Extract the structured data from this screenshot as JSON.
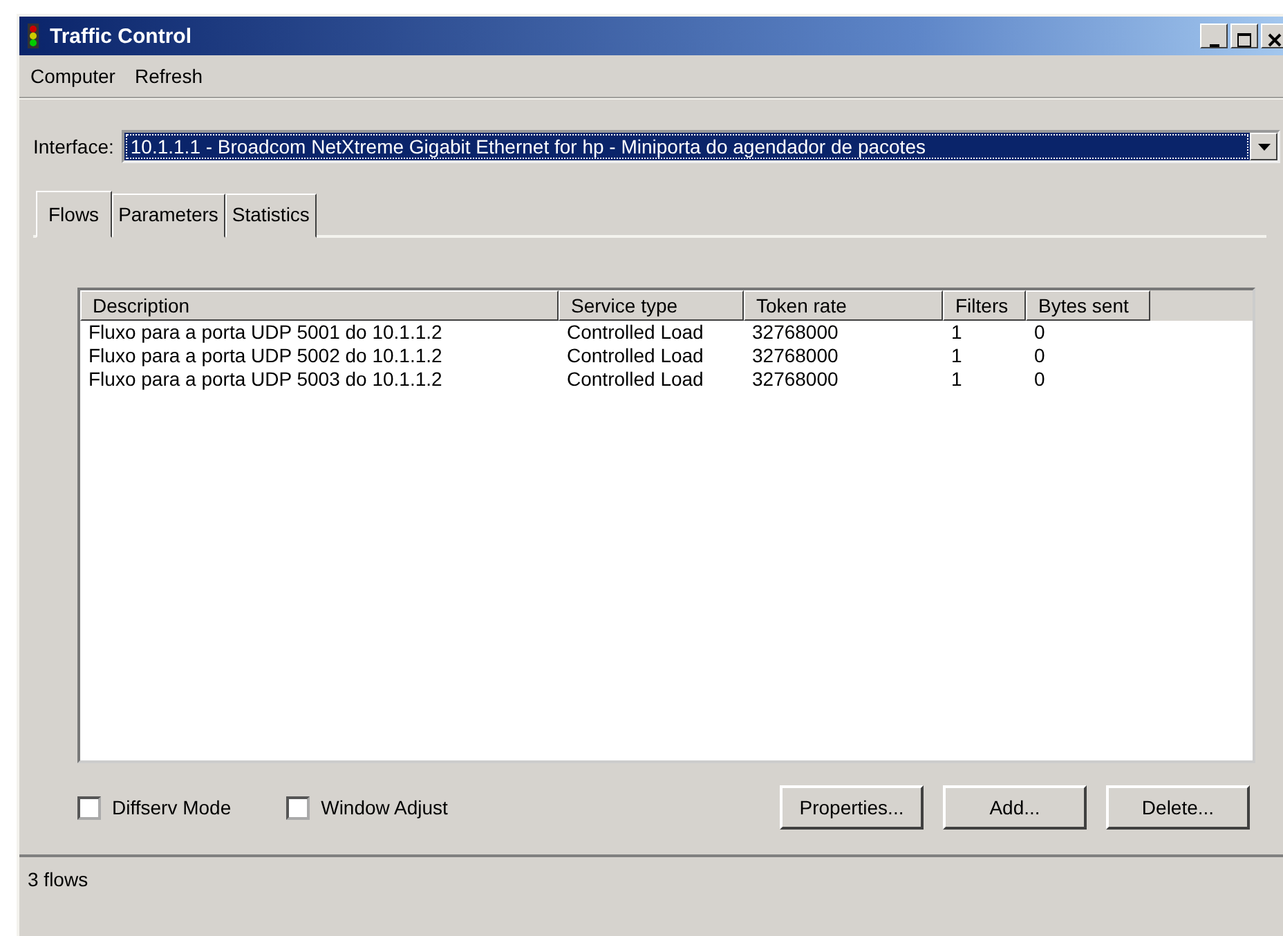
{
  "window": {
    "title": "Traffic Control"
  },
  "menu": [
    "Computer",
    "Refresh"
  ],
  "interface": {
    "label": "Interface:",
    "value": "10.1.1.1 - Broadcom NetXtreme Gigabit Ethernet for hp - Miniporta do agendador de pacotes"
  },
  "tabs": [
    {
      "label": "Flows",
      "selected": true
    },
    {
      "label": "Parameters",
      "selected": false
    },
    {
      "label": "Statistics",
      "selected": false
    }
  ],
  "table": {
    "columns": [
      "Description",
      "Service type",
      "Token rate",
      "Filters",
      "Bytes sent"
    ],
    "rows": [
      [
        "Fluxo para a porta UDP 5001 do 10.1.1.2",
        "Controlled Load",
        "32768000",
        "1",
        "0"
      ],
      [
        "Fluxo para a porta UDP 5002 do 10.1.1.2",
        "Controlled Load",
        "32768000",
        "1",
        "0"
      ],
      [
        "Fluxo para a porta UDP 5003 do 10.1.1.2",
        "Controlled Load",
        "32768000",
        "1",
        "0"
      ]
    ]
  },
  "options": [
    {
      "label": "Diffserv Mode",
      "checked": false
    },
    {
      "label": "Window Adjust",
      "checked": false
    }
  ],
  "buttons": [
    "Properties...",
    "Add...",
    "Delete..."
  ],
  "status_bar": "3 flows"
}
